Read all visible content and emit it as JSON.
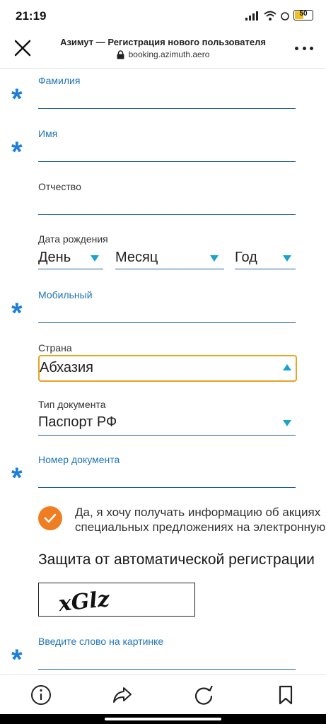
{
  "status": {
    "time": "21:19",
    "battery": "50"
  },
  "header": {
    "title": "Азимут — Регистрация нового пользователя",
    "url": "booking.azimuth.aero"
  },
  "form": {
    "surname_label": "Фамилия",
    "name_label": "Имя",
    "patronymic_label": "Отчество",
    "birth_label": "Дата рождения",
    "day": "День",
    "month": "Месяц",
    "year": "Год",
    "mobile_label": "Мобильный",
    "country_label": "Страна",
    "country_value": "Абхазия",
    "doctype_label": "Тип документа",
    "doctype_value": "Паспорт РФ",
    "docnum_label": "Номер документа",
    "consent_line1": "Да, я хочу получать информацию об акциях",
    "consent_line2": "специальных предложениях на электронную",
    "captcha_title": "Защита от автоматической регистрации",
    "captcha_text": "xGlz",
    "captcha_input_label": "Введите слово на картинке",
    "required_mark": "*"
  },
  "colors": {
    "accent": "#1f74b8",
    "required": "#1e7fd8",
    "focus": "#e6a421",
    "checkbox": "#ef7d22",
    "arrow": "#1aa3c8"
  },
  "bottom_nav": [
    "info-icon",
    "share-icon",
    "refresh-icon",
    "bookmark-icon"
  ]
}
